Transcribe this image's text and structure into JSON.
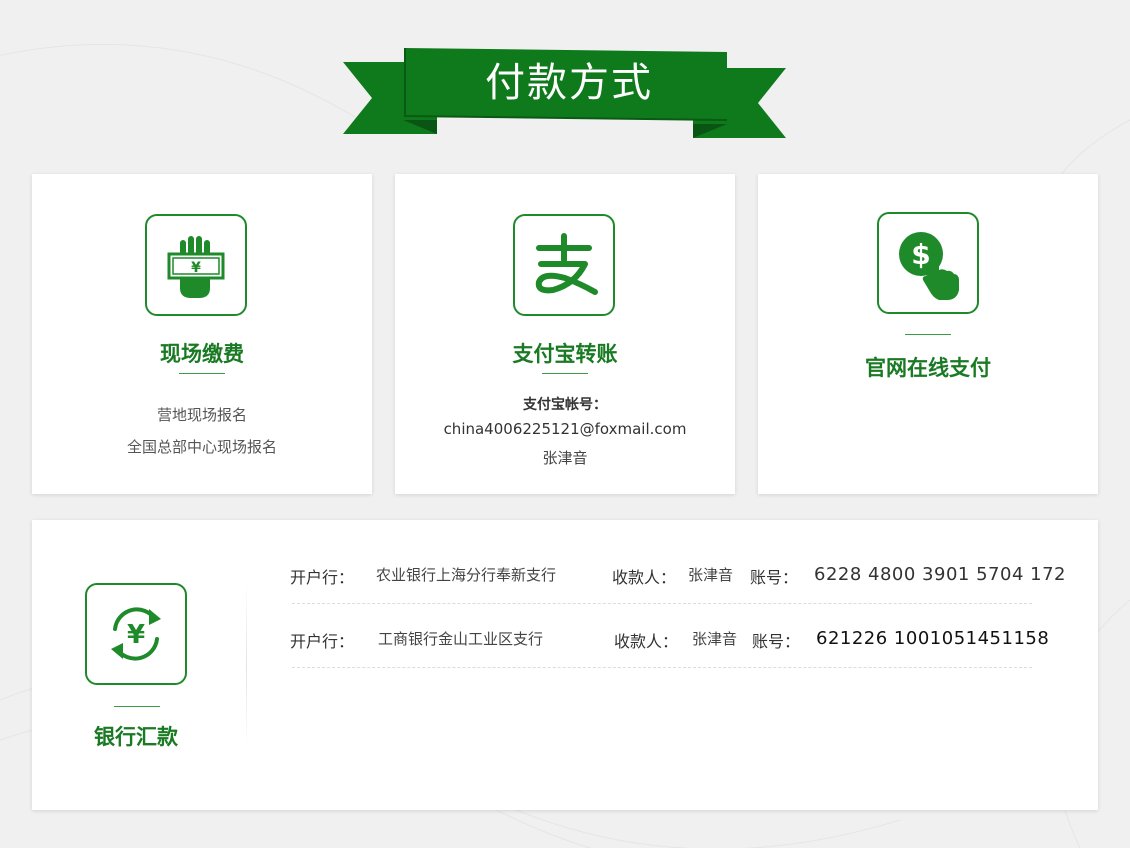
{
  "header": {
    "title": "付款方式"
  },
  "colors": {
    "brand_green": "#1a7a24",
    "ribbon_green": "#0f7a1c",
    "ribbon_dark": "#0c6016"
  },
  "cards": [
    {
      "icon": "cash-hand-icon",
      "title": "现场缴费",
      "lines": [
        "营地现场报名",
        "全国总部中心现场报名"
      ]
    },
    {
      "icon": "alipay-icon",
      "title": "支付宝转账",
      "label": "支付宝帐号：",
      "email": "china4006225121@foxmail.com",
      "name": "张津音"
    },
    {
      "icon": "dollar-click-icon",
      "title": "官网在线支付"
    }
  ],
  "bank": {
    "icon": "yuan-exchange-icon",
    "title": "银行汇款",
    "rows": [
      {
        "bank_label": "开户行：",
        "bank_name": "农业银行上海分行奉新支行",
        "payee_label": "收款人：",
        "payee": "张津音",
        "account_label": "账号：",
        "account": "6228 4800 3901 5704 172"
      },
      {
        "bank_label": "开户行：",
        "bank_name": "工商银行金山工业区支行",
        "payee_label": "收款人：",
        "payee": "张津音",
        "account_label": "账号：",
        "account": "621226 1001051451158"
      }
    ]
  }
}
